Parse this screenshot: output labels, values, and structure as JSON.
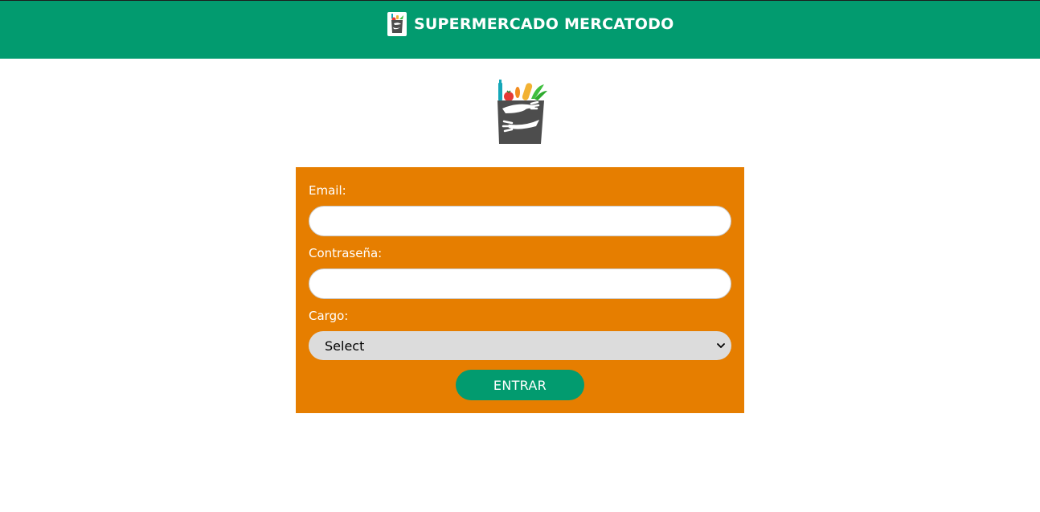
{
  "header": {
    "title": "SUPERMERCADO MERCATODO",
    "logo_icon": "grocery-bag-logo-icon"
  },
  "hero": {
    "logo_icon": "grocery-bag-logo-icon"
  },
  "form": {
    "email_label": "Email:",
    "email_value": "",
    "password_label": "Contraseña:",
    "password_value": "",
    "role_label": "Cargo:",
    "role_selected": "Select",
    "submit_label": "ENTRAR"
  },
  "colors": {
    "header_bg": "#029b6f",
    "panel_bg": "#e67e00",
    "button_bg": "#029b6f",
    "select_bg": "#dcdcdc"
  }
}
